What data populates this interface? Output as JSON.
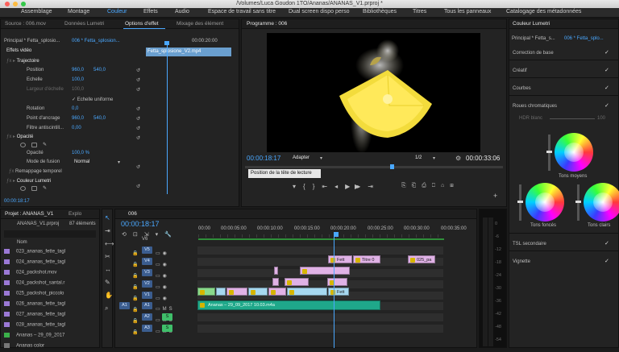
{
  "window": {
    "title": "/Volumes/Luca Goudon 1TO/Ananas/ANANAS_V1.prproj *"
  },
  "workspaces": [
    "Assemblage",
    "Montage",
    "Couleur",
    "Effets",
    "Audio",
    "Espace de travail sans titre",
    "Dual screen dispo perso",
    "Bibliothèques",
    "Titres",
    "Tous les panneaux",
    "Catalogage des métadonnées"
  ],
  "active_workspace": "Couleur",
  "source_panel": {
    "tabs": [
      "Source : 006.mov",
      "Données Lumetri",
      "Options d'effet",
      "Mixage des élément"
    ],
    "header_left": "Principal * Fetta_splosio...",
    "header_right": "006 * Fetta_splosion...",
    "timecode_ruler": "00:00:20:00",
    "clip_label": "Fetta_splosione_V2.mp4",
    "section_video": "Effets vidéo",
    "fx_motion": "Trajectoire",
    "position_label": "Position",
    "position_x": "960,0",
    "position_y": "540,0",
    "echelle_label": "Echelle",
    "echelle_val": "100,0",
    "largeur_label": "Largeur d'échelle",
    "largeur_val": "100,0",
    "uniform_label": "Echelle uniforme",
    "rotation_label": "Rotation",
    "rotation_val": "0,0",
    "ancrage_label": "Point d'ancrage",
    "ancrage_x": "960,0",
    "ancrage_y": "540,0",
    "filtre_label": "Filtre antiscintill...",
    "filtre_val": "0,00",
    "fx_opacity": "Opacité",
    "opacity_label": "Opacité",
    "opacity_val": "100,0 %",
    "mode_label": "Mode de fusion",
    "mode_val": "Normal",
    "remap": "Remappage temporel",
    "lumetri": "Couleur Lumetri",
    "timecode": "00:00:18:17"
  },
  "program_panel": {
    "tab": "Programme : 006",
    "timecode": "00:00:18:17",
    "fit": "Adapter",
    "resolution": "1/2",
    "duration": "00:00:33:06",
    "tooltip": "Position de la tête de lecture"
  },
  "lumetri_panel": {
    "tab": "Couleur Lumetri",
    "header_left": "Principal * Fetta_s...",
    "header_right": "006 * Fetta_splo...",
    "sections": [
      "Correction de base",
      "Créatif",
      "Courbes",
      "Roues chromatiques",
      "TSL secondaire",
      "Vignette"
    ],
    "hdr_label": "HDR blanc",
    "hdr_val": "100",
    "wheel_mid": "Tons moyens",
    "wheel_shadow": "Tons foncés",
    "wheel_high": "Tons clairs"
  },
  "project_panel": {
    "tab": "Projet : ANANAS_V1",
    "tab2": "Explo",
    "file": "ANANAS_V1.prproj",
    "count": "87 éléments",
    "col_name": "Nom",
    "items": [
      "023_ananas_fette_tagl",
      "024_ananas_fette_tagl",
      "024_packshot.mov",
      "024_packshot_santal.r",
      "025_packshot_piccolo",
      "026_ananas_fette_tagl",
      "027_ananas_fette_tagl",
      "028_ananas_fette_tagl",
      "Ananas – 29_09_2017",
      "Ananas color"
    ]
  },
  "timeline": {
    "tab": "006",
    "timecode": "00:00:18:17",
    "ruler": [
      "00:00",
      "00:00:05:00",
      "00:00:10:00",
      "00:00:15:00",
      "00:00:20:00",
      "00:00:25:00",
      "00:00:30:00",
      "00:00:35:00"
    ],
    "tracks_v": [
      "V6",
      "V5",
      "V4",
      "V3",
      "V2",
      "V1"
    ],
    "tracks_a": [
      "A1",
      "A2",
      "A3"
    ],
    "src_a": "A1",
    "clips": {
      "fett_a": "Fett",
      "titre": "Titre 0",
      "c025": "025_pa",
      "fett_b": "Fett",
      "audio": "Ananas – 29_09_2017 10.03.m4a"
    },
    "meter_scale": [
      "0",
      "-6",
      "-12",
      "-18",
      "-24",
      "-30",
      "-36",
      "-42",
      "-48",
      "-54"
    ]
  },
  "colors": {
    "accent": "#4aa8ff",
    "clip_fx": "#e0b2e6",
    "clip_video": "#a6d8f0",
    "clip_green": "#89d98c",
    "clip_audio": "#1fa88a"
  }
}
